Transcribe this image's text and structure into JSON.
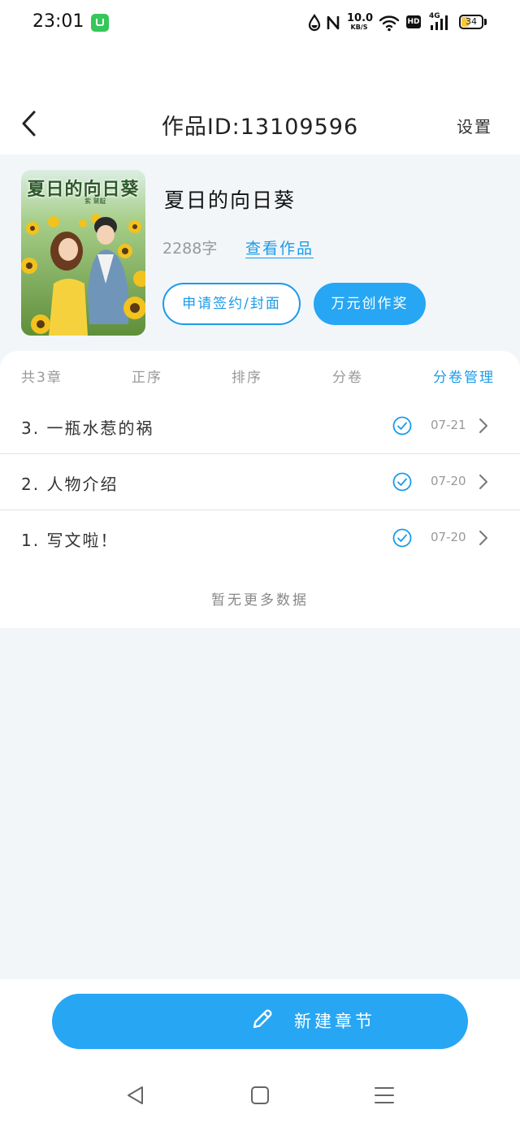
{
  "status_bar": {
    "time": "23:01",
    "net_speed_value": "10.0",
    "net_speed_unit": "KB/S",
    "hd": "HD",
    "signal_label": "4G",
    "battery": "34"
  },
  "header": {
    "title": "作品ID:13109596",
    "settings_label": "设置"
  },
  "work": {
    "cover_title": "夏日的向日葵",
    "cover_subtitle": "紫 鷲靛",
    "name": "夏日的向日葵",
    "word_count": "2288字",
    "view_label": "查看作品",
    "sign_button": "申请签约/封面",
    "award_button": "万元创作奖"
  },
  "toolbar": {
    "total": "共3章",
    "order": "正序",
    "sort": "排序",
    "volume": "分卷",
    "volume_manage": "分卷管理"
  },
  "chapters": [
    {
      "title": "3. 一瓶水惹的祸",
      "date": "07-21"
    },
    {
      "title": "2. 人物介绍",
      "date": "07-20"
    },
    {
      "title": "1. 写文啦！",
      "date": "07-20"
    }
  ],
  "no_more_text": "暂无更多数据",
  "new_chapter_label": "新建章节",
  "colors": {
    "accent": "#27a6f4",
    "link": "#1b9be8",
    "background": "#f2f6f9"
  },
  "icons": {
    "back": "chevron-left-icon",
    "check": "check-circle-icon",
    "chevron": "chevron-right-icon",
    "pencil": "pencil-icon",
    "nav_back": "triangle-back-icon",
    "nav_home": "square-home-icon",
    "nav_menu": "menu-lines-icon"
  }
}
